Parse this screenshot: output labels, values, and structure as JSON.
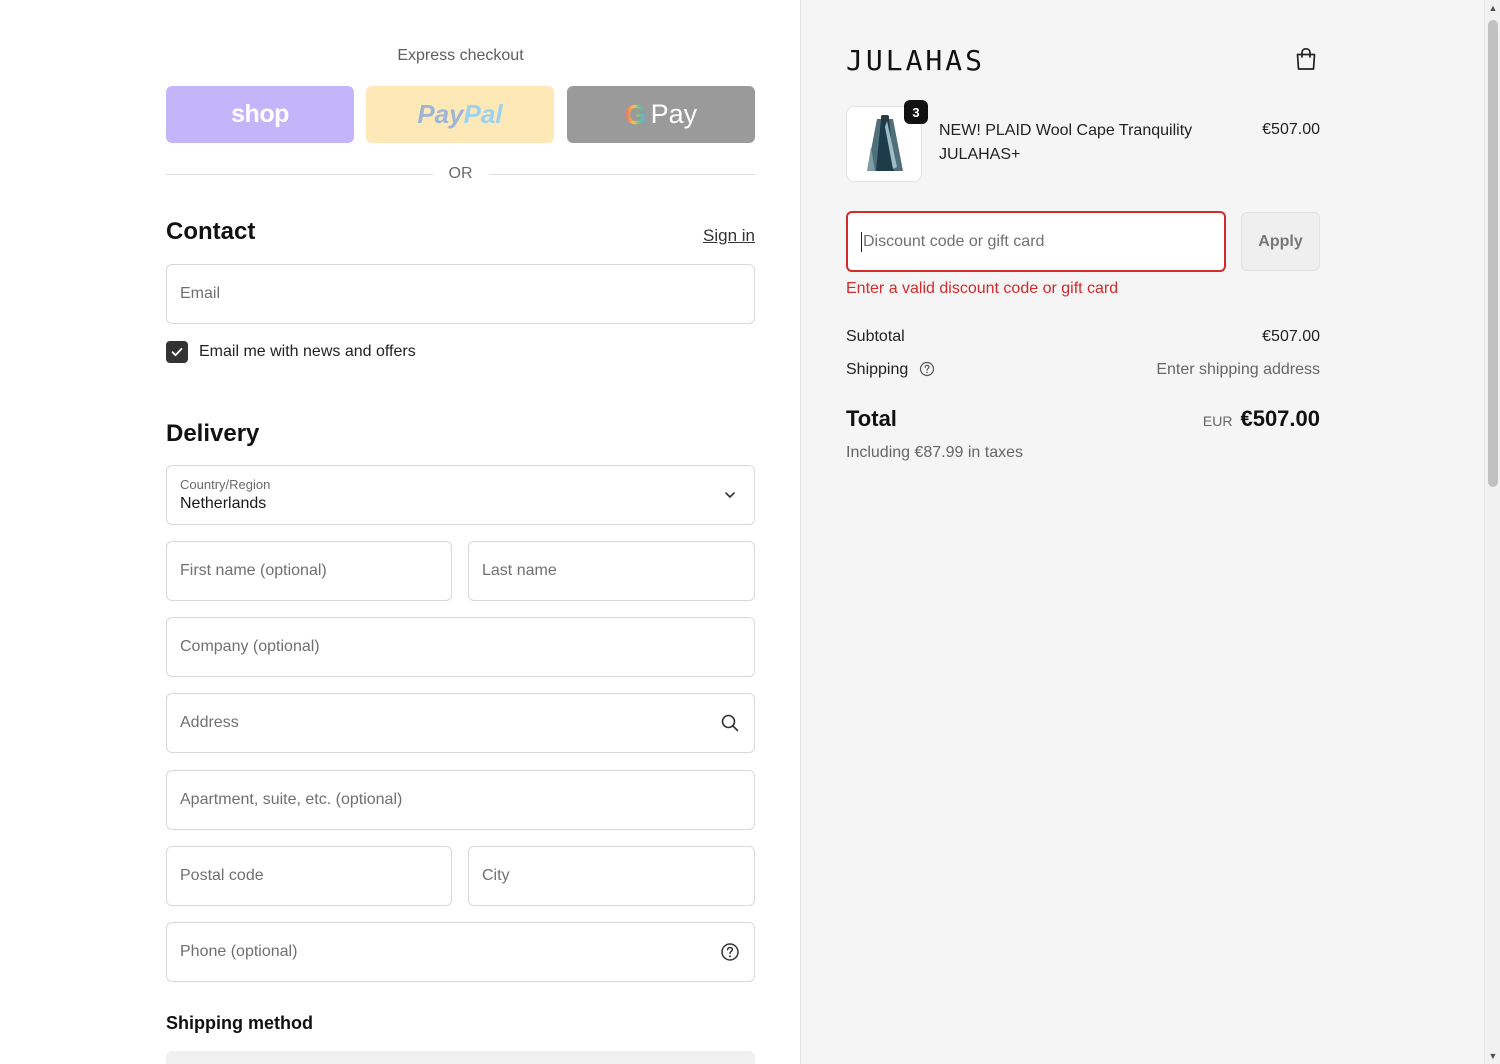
{
  "express": {
    "title": "Express checkout",
    "shop_label": "shop",
    "paypal_part1": "Pay",
    "paypal_part2": "Pal",
    "gpay_g": "G",
    "gpay_label": "Pay",
    "or_text": "OR"
  },
  "contact": {
    "title": "Contact",
    "signin_label": "Sign in",
    "email_placeholder": "Email",
    "newsletter_label": "Email me with news and offers",
    "newsletter_checked": true
  },
  "delivery": {
    "title": "Delivery",
    "country_label": "Country/Region",
    "country_value": "Netherlands",
    "first_name_placeholder": "First name (optional)",
    "last_name_placeholder": "Last name",
    "company_placeholder": "Company (optional)",
    "address_placeholder": "Address",
    "apartment_placeholder": "Apartment, suite, etc. (optional)",
    "postal_placeholder": "Postal code",
    "city_placeholder": "City",
    "phone_placeholder": "Phone (optional)"
  },
  "shipping_method": {
    "title": "Shipping method"
  },
  "summary": {
    "brand": "JULAHAS",
    "product": {
      "name": "NEW! PLAID Wool Cape Tranquility JULAHAS+",
      "price": "€507.00",
      "quantity": "3"
    },
    "discount_placeholder": "Discount code or gift card",
    "apply_label": "Apply",
    "discount_error": "Enter a valid discount code or gift card",
    "subtotal_label": "Subtotal",
    "subtotal_value": "€507.00",
    "shipping_label": "Shipping",
    "shipping_value": "Enter shipping address",
    "total_label": "Total",
    "total_currency": "EUR",
    "total_value": "€507.00",
    "taxes_text": "Including €87.99 in taxes"
  },
  "colors": {
    "error": "#d22b2b",
    "shop_button": "#c4b5fb",
    "paypal_button": "#fde8b8",
    "gpay_button": "#9a9a9a",
    "summary_bg": "#f5f5f5"
  }
}
